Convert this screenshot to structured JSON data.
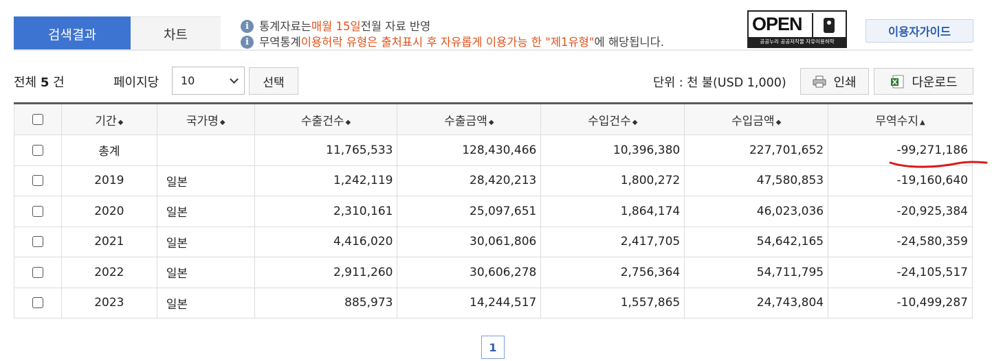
{
  "tabs": [
    {
      "label": "검색결과",
      "active": true
    },
    {
      "label": "차트",
      "active": false
    }
  ],
  "notice": {
    "line1": {
      "pre": "통계자료는 ",
      "highlight": "매월 15일",
      "post": " 전월 자료 반영"
    },
    "line2": {
      "pre": "무역통계 ",
      "highlight": "이용허락 유형은 출처표시 후 자유롭게 이용가능 한 \"제1유형\"",
      "post": "에 해당됩니다."
    }
  },
  "open_logo": {
    "text": "OPEN",
    "badge": "출처표시",
    "sub": "공공누리  공공저작물 자유이용허락"
  },
  "guide_button": "이용자가이드",
  "toolbar": {
    "total_pre": "전체 ",
    "total_count": "5",
    "total_post": " 건",
    "perpage_label": "페이지당",
    "perpage_value": "10",
    "select_button": "선택",
    "unit": "단위 : 천 불(USD 1,000)",
    "print_button": "인쇄",
    "download_button": "다운로드"
  },
  "table": {
    "headers": [
      "기간",
      "국가명",
      "수출건수",
      "수출금액",
      "수입건수",
      "수입금액",
      "무역수지"
    ],
    "header_sort": [
      "◆",
      "◆",
      "◆",
      "◆",
      "◆",
      "◆",
      "▲"
    ],
    "rows": [
      {
        "period": "총계",
        "country": "",
        "export_count": "11,765,533",
        "export_amount": "128,430,466",
        "import_count": "10,396,380",
        "import_amount": "227,701,652",
        "balance": "-99,271,186"
      },
      {
        "period": "2019",
        "country": "일본",
        "export_count": "1,242,119",
        "export_amount": "28,420,213",
        "import_count": "1,800,272",
        "import_amount": "47,580,853",
        "balance": "-19,160,640"
      },
      {
        "period": "2020",
        "country": "일본",
        "export_count": "2,310,161",
        "export_amount": "25,097,651",
        "import_count": "1,864,174",
        "import_amount": "46,023,036",
        "balance": "-20,925,384"
      },
      {
        "period": "2021",
        "country": "일본",
        "export_count": "4,416,020",
        "export_amount": "30,061,806",
        "import_count": "2,417,705",
        "import_amount": "54,642,165",
        "balance": "-24,580,359"
      },
      {
        "period": "2022",
        "country": "일본",
        "export_count": "2,911,260",
        "export_amount": "30,606,278",
        "import_count": "2,756,364",
        "import_amount": "54,711,795",
        "balance": "-24,105,517"
      },
      {
        "period": "2023",
        "country": "일본",
        "export_count": "885,973",
        "export_amount": "14,244,517",
        "import_count": "1,557,865",
        "import_amount": "24,743,804",
        "balance": "-10,499,287"
      }
    ]
  },
  "pagination": {
    "current": "1"
  },
  "colors": {
    "accent": "#3e74d1",
    "highlight": "#e0521d",
    "annotation": "#d91a1a"
  }
}
